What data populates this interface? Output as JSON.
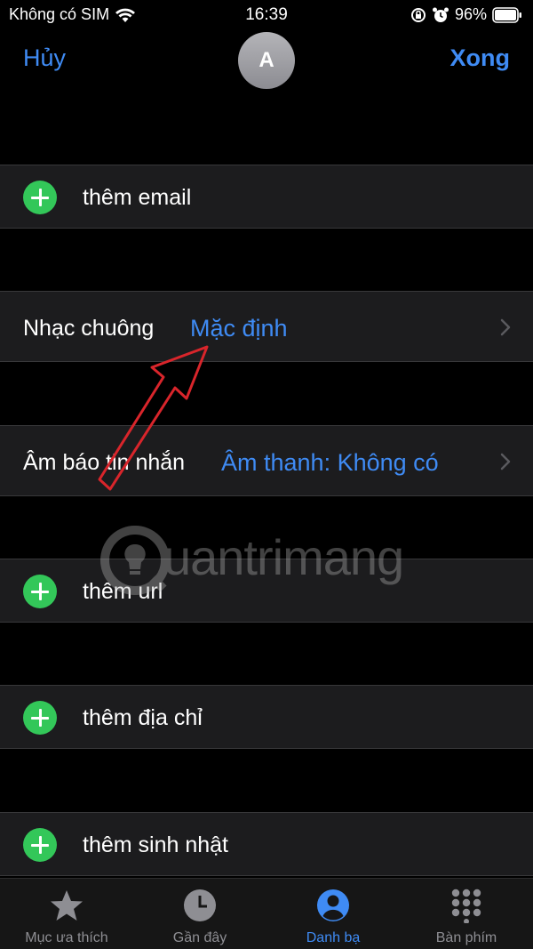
{
  "status_bar": {
    "carrier": "Không có SIM",
    "time": "16:39",
    "battery": "96%"
  },
  "nav": {
    "cancel_label": "Hủy",
    "done_label": "Xong",
    "avatar_initial": "A"
  },
  "rows": {
    "add_email": "thêm email",
    "ringtone_label": "Nhạc chuông",
    "ringtone_value": "Mặc định",
    "text_tone_label": "Âm báo tin nhắn",
    "text_tone_value": "Âm thanh: Không có",
    "add_url": "thêm url",
    "add_address": "thêm địa chỉ",
    "add_birthday": "thêm sinh nhật"
  },
  "watermark": "uantrimang",
  "tabs": [
    {
      "label": "Mục ưa thích",
      "icon": "star-icon",
      "active": false
    },
    {
      "label": "Gần đây",
      "icon": "clock-icon",
      "active": false
    },
    {
      "label": "Danh bạ",
      "icon": "contact-icon",
      "active": true
    },
    {
      "label": "Bàn phím",
      "icon": "keypad-icon",
      "active": false
    }
  ],
  "colors": {
    "accent": "#3f8bf4",
    "add_green": "#33c759",
    "row_bg": "#1c1c1e",
    "annotation_red": "#d9252b"
  }
}
